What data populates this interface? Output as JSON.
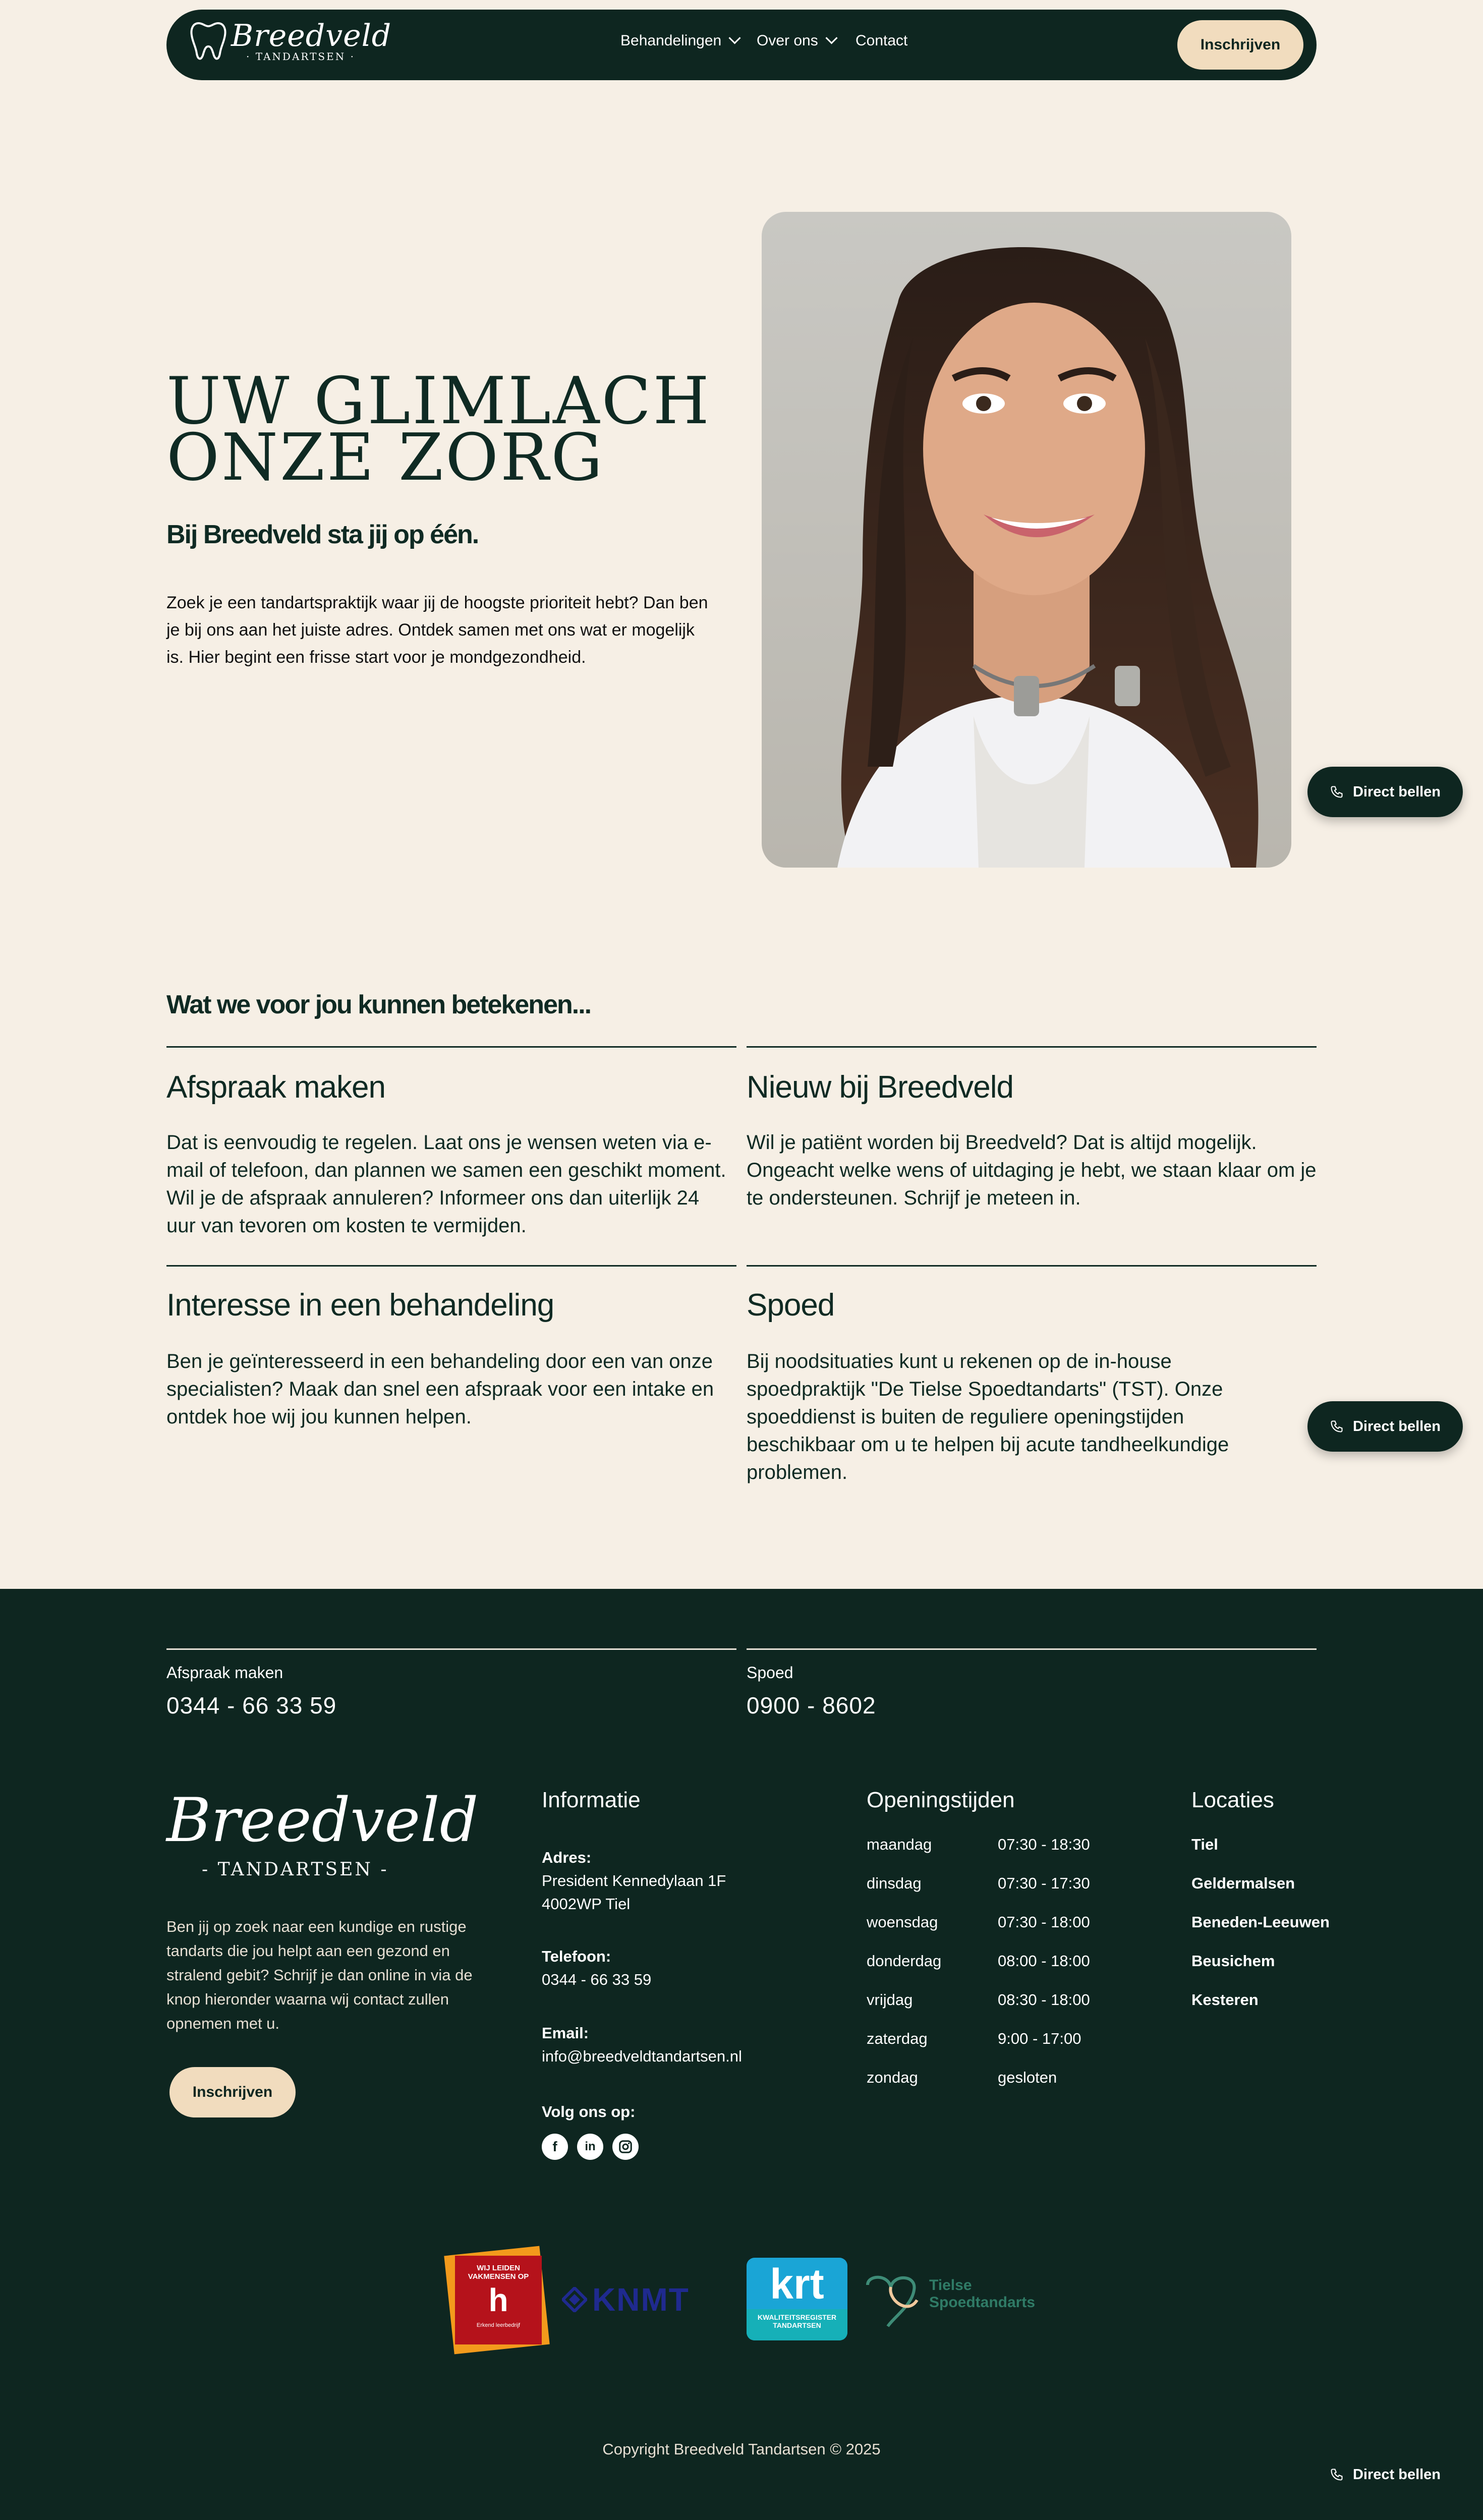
{
  "nav": {
    "logo_word": "Breedveld",
    "logo_sub": "· TANDARTSEN ·",
    "links": [
      "Behandelingen",
      "Over ons",
      "Contact"
    ],
    "cta": "Inschrijven"
  },
  "hero": {
    "title_line1": "UW GLIMLACH",
    "title_line2": "ONZE ZORG",
    "subtitle": "Bij Breedveld sta jij op één.",
    "body": "Zoek je een tandartspraktijk waar jij de hoogste prioriteit hebt? Dan ben je bij ons aan het juiste adres. Ontdek samen met ons wat er mogelijk is. Hier begint een frisse start voor je mondgezondheid."
  },
  "call_button": "Direct bellen",
  "services": {
    "heading": "Wat we voor jou kunnen betekenen...",
    "cards": [
      {
        "title": "Afspraak maken",
        "text": "Dat is eenvoudig te regelen. Laat ons je wensen weten via e-mail of telefoon, dan plannen we samen een geschikt moment. Wil je de afspraak annuleren? Informeer ons dan uiterlijk 24 uur van tevoren om kosten te vermijden."
      },
      {
        "title": "Nieuw bij Breedveld",
        "text": "Wil je patiënt worden bij Breedveld? Dat is altijd mogelijk. Ongeacht welke wens of uitdaging je hebt, we staan klaar om je te ondersteunen. Schrijf je meteen in."
      },
      {
        "title": "Interesse in een behandeling",
        "text": "Ben je geïnteresseerd in een behandeling door een van onze specialisten? Maak dan snel een afspraak voor een intake en ontdek hoe wij jou kunnen helpen."
      },
      {
        "title": "Spoed",
        "text": "Bij noodsituaties kunt u rekenen op de in-house spoedpraktijk \"De Tielse Spoedtandarts\" (TST). Onze spoeddienst is buiten de reguliere openingstijden beschikbaar om u te helpen bij acute tandheelkundige problemen."
      }
    ]
  },
  "footer": {
    "contact": [
      {
        "label": "Afspraak maken",
        "phone": "0344 - 66 33 59"
      },
      {
        "label": "Spoed",
        "phone": "0900 - 8602"
      }
    ],
    "logo_word": "Breedveld",
    "logo_sub": "- TANDARTSEN -",
    "description": "Ben jij op zoek naar een kundige en rustige tandarts die jou helpt aan een gezond en stralend gebit? Schrijf je dan online in via de knop hieronder waarna wij contact zullen opnemen met u.",
    "cta": "Inschrijven",
    "info": {
      "heading": "Informatie",
      "address_label": "Adres:",
      "address_line1": "President Kennedylaan 1F",
      "address_line2": "4002WP  Tiel",
      "phone_label": "Telefoon:",
      "phone": "0344 - 66 33 59",
      "email_label": "Email:",
      "email": "info@breedveldtandartsen.nl",
      "follow_label": "Volg ons op:",
      "socials": [
        "facebook-icon",
        "linkedin-icon",
        "instagram-icon"
      ]
    },
    "hours": {
      "heading": "Openingstijden",
      "rows": [
        {
          "day": "maandag",
          "time": "07:30 - 18:30"
        },
        {
          "day": "dinsdag",
          "time": "07:30 - 17:30"
        },
        {
          "day": "woensdag",
          "time": "07:30 - 18:00"
        },
        {
          "day": "donderdag",
          "time": "08:00 - 18:00"
        },
        {
          "day": "vrijdag",
          "time": "08:30 - 18:00"
        },
        {
          "day": "zaterdag",
          "time": "9:00 - 17:00"
        },
        {
          "day": "zondag",
          "time": "gesloten"
        }
      ]
    },
    "locations": {
      "heading": "Locaties",
      "items": [
        "Tiel",
        "Geldermalsen",
        "Beneden-Leeuwen",
        "Beusichem",
        "Kesteren"
      ]
    },
    "badges": {
      "hp_line1": "WIJ LEIDEN",
      "hp_line2": "VAKMENSEN OP",
      "hp_footer": "Erkend leerbedrijf",
      "knmt": "KNMT",
      "krt": "krt",
      "krt_sub1": "KWALITEITSREGISTER",
      "krt_sub2": "TANDARTSEN",
      "tst_line1": "Tielse",
      "tst_line2": "Spoedtandarts"
    },
    "copyright": "Copyright Breedveld Tandartsen © 2025"
  },
  "colors": {
    "dark_green": "#0e2620",
    "cream": "#f6efe5",
    "button_cream": "#f1dcbe"
  }
}
